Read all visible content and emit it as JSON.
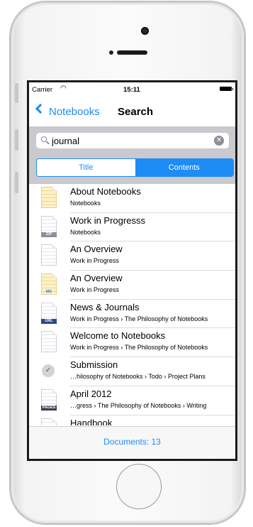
{
  "status_bar": {
    "carrier": "Carrier",
    "wifi_icon": "wifi-icon",
    "time": "15:11",
    "battery_icon": "battery-icon"
  },
  "nav": {
    "back_label": "Notebooks",
    "title": "Search"
  },
  "search": {
    "value": "journal",
    "placeholder": ""
  },
  "segments": [
    {
      "label": "Title",
      "selected": false
    },
    {
      "label": "Contents",
      "selected": true
    }
  ],
  "results": [
    {
      "title": "About Notebooks",
      "subtitle": "Notebooks",
      "icon": "yellow-document-icon"
    },
    {
      "title": "Work in Progresss",
      "subtitle": "Notebooks",
      "icon": "zip-document-icon",
      "tag": "ZIP"
    },
    {
      "title": "An Overview",
      "subtitle": "Work in Progress",
      "icon": "document-icon"
    },
    {
      "title": "An Overview",
      "subtitle": "Work in Progress",
      "icon": "markdown-document-icon",
      "tag": "MD"
    },
    {
      "title": "News & Journals",
      "subtitle": "Work in Progress › The Philosophy of Notebooks",
      "icon": "url-document-icon",
      "tag": "URL"
    },
    {
      "title": "Welcome to Notebooks",
      "subtitle": "Work in Progress › The Philosophy of Notebooks",
      "icon": "document-icon"
    },
    {
      "title": "Submission",
      "subtitle": "…hilosophy of Notebooks › Todo › Project Plans",
      "icon": "checkmark-task-icon"
    },
    {
      "title": "April 2012",
      "subtitle": "…gress › The Philosophy of Notebooks › Writing",
      "icon": "pages-document-icon",
      "tag": "PAGES"
    },
    {
      "title": "Handbook",
      "subtitle": "",
      "icon": "document-icon"
    }
  ],
  "toolbar": {
    "count_label": "Documents: 13"
  },
  "colors": {
    "accent": "#1d8cf5",
    "search_bar_bg": "#c9c9ce",
    "toolbar_bg": "#f7f7f8"
  }
}
